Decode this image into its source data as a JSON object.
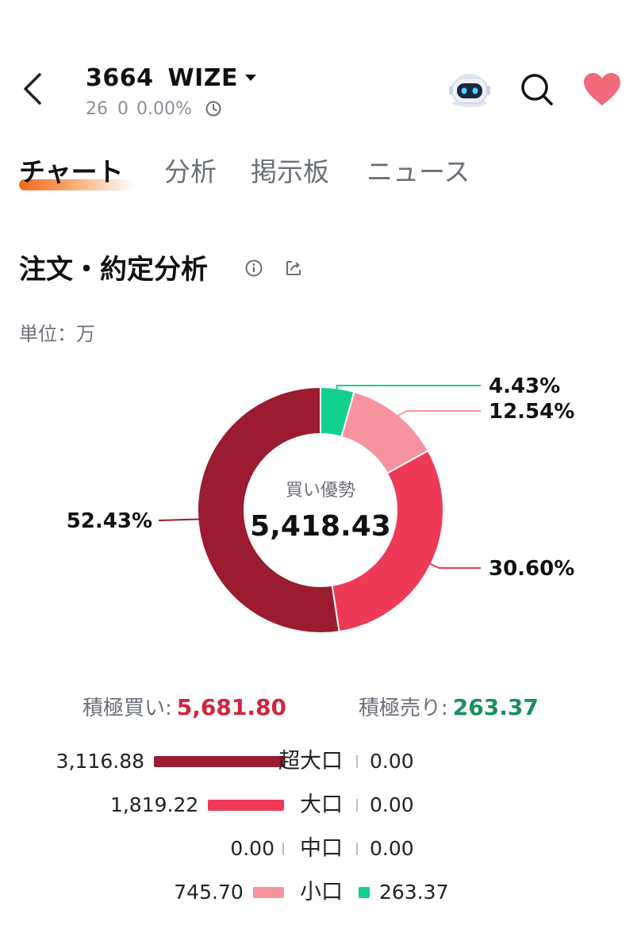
{
  "header": {
    "ticker_code": "3664",
    "ticker_name": "WIZE",
    "price": "26",
    "change": "0",
    "change_pct": "0.00%",
    "icons": [
      "back-icon",
      "caret-down-icon",
      "clock-icon",
      "robot-assistant-icon",
      "search-icon",
      "heart-icon"
    ],
    "heart_color": "#f06a7c"
  },
  "tabs": [
    {
      "label": "チャート",
      "active": true
    },
    {
      "label": "分析",
      "active": false
    },
    {
      "label": "掲示板",
      "active": false
    },
    {
      "label": "ニュース",
      "active": false
    }
  ],
  "section": {
    "title": "注文・約定分析",
    "unit": "単位：万"
  },
  "chart_data": {
    "type": "pie",
    "center_label": "買い優勢",
    "center_value": "5,418.43",
    "slices": [
      {
        "label": "4.43%",
        "value": 4.43,
        "color": "#12d18e"
      },
      {
        "label": "12.54%",
        "value": 12.54,
        "color": "#f7939f"
      },
      {
        "label": "30.60%",
        "value": 30.6,
        "color": "#ee3a57"
      },
      {
        "label": "52.43%",
        "value": 52.43,
        "color": "#9b1b30"
      }
    ]
  },
  "summary": {
    "buy_label": "積極買い:",
    "buy_value": "5,681.80",
    "sell_label": "積極売り:",
    "sell_value": "263.37",
    "buy_color": "#d2243a",
    "sell_color": "#1a8f5f"
  },
  "breakdown": [
    {
      "category": "超大口",
      "buy": "3,116.88",
      "buy_value": 3116.88,
      "sell": "0.00",
      "sell_value": 0,
      "buy_color": "#9b1b30",
      "sell_color": "#12d18e"
    },
    {
      "category": "大口",
      "buy": "1,819.22",
      "buy_value": 1819.22,
      "sell": "0.00",
      "sell_value": 0,
      "buy_color": "#ee3a57",
      "sell_color": "#12d18e"
    },
    {
      "category": "中口",
      "buy": "0.00",
      "buy_value": 0,
      "sell": "0.00",
      "sell_value": 0,
      "buy_color": "#f7939f",
      "sell_color": "#12d18e"
    },
    {
      "category": "小口",
      "buy": "745.70",
      "buy_value": 745.7,
      "sell": "263.37",
      "sell_value": 263.37,
      "buy_color": "#f7939f",
      "sell_color": "#12d18e"
    }
  ]
}
